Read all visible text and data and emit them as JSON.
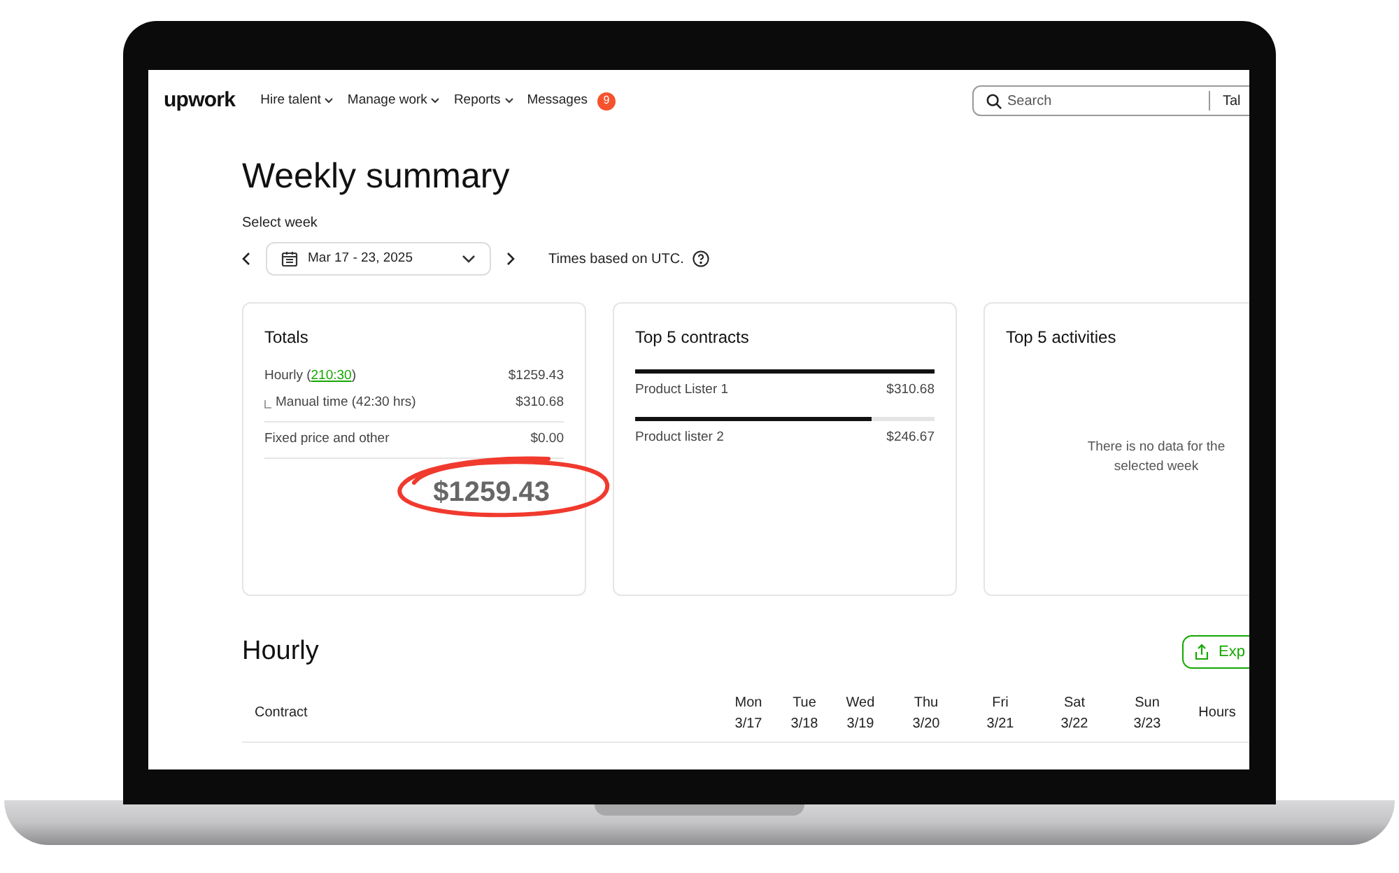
{
  "nav": {
    "logo": "upwork",
    "items": [
      {
        "label": "Hire talent",
        "dropdown": true
      },
      {
        "label": "Manage work",
        "dropdown": true
      },
      {
        "label": "Reports",
        "dropdown": true
      },
      {
        "label": "Messages",
        "dropdown": false,
        "badge": "9"
      }
    ],
    "search": {
      "placeholder": "Search",
      "scope": "Tal"
    }
  },
  "page": {
    "title": "Weekly summary",
    "week_label": "Select week",
    "week": "Mar 17 - 23, 2025",
    "timezone_note": "Times based on UTC."
  },
  "totals": {
    "title": "Totals",
    "rows": [
      {
        "kind": "hourly",
        "label_prefix": "Hourly (",
        "link": "210:30",
        "label_suffix": ")",
        "amount": "$1259.43"
      },
      {
        "kind": "sub",
        "label": "Manual time (42:30 hrs)",
        "amount": "$310.68"
      },
      {
        "kind": "plain",
        "label": "Fixed price and other",
        "amount": "$0.00"
      }
    ],
    "total": "$1259.43",
    "circled": true
  },
  "top_contracts": {
    "title": "Top 5 contracts",
    "items": [
      {
        "name": "Product Lister 1",
        "amount": "$310.68",
        "level": 1
      },
      {
        "name": "Product lister 2",
        "amount": "$246.67",
        "level": 0.79
      }
    ]
  },
  "top_activities": {
    "title": "Top 5 activities",
    "empty_message": "There is no data for the selected week"
  },
  "hourly": {
    "title": "Hourly",
    "export_button": "Exp",
    "columns": [
      {
        "day": "Contract"
      },
      {
        "day": "Mon",
        "date": "3/17"
      },
      {
        "day": "Tue",
        "date": "3/18"
      },
      {
        "day": "Wed",
        "date": "3/19"
      },
      {
        "day": "Thu",
        "date": "3/20"
      },
      {
        "day": "Fri",
        "date": "3/21"
      },
      {
        "day": "Sat",
        "date": "3/22"
      },
      {
        "day": "Sun",
        "date": "3/23"
      },
      {
        "day": "Hours"
      }
    ]
  }
}
